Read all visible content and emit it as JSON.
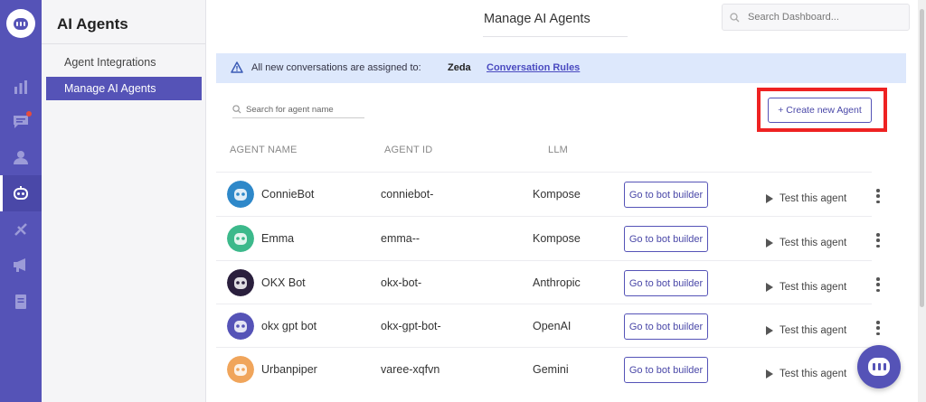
{
  "colors": {
    "brand": "#5553b7",
    "highlight": "#ee2222",
    "banner": "#dde8fc"
  },
  "rail": {
    "items": [
      {
        "icon": "reports-icon"
      },
      {
        "icon": "conversations-icon",
        "badge": true
      },
      {
        "icon": "contacts-icon"
      },
      {
        "icon": "ai-agents-icon",
        "active": true
      },
      {
        "icon": "integrations-icon"
      },
      {
        "icon": "campaigns-icon"
      },
      {
        "icon": "knowledge-base-icon"
      }
    ]
  },
  "sidebar": {
    "title": "AI Agents",
    "items": [
      {
        "label": "Agent Integrations"
      },
      {
        "label": "Manage AI Agents",
        "active": true
      }
    ]
  },
  "header": {
    "title": "Manage AI Agents",
    "search_placeholder": "Search Dashboard..."
  },
  "banner": {
    "text": "All new conversations are assigned to:",
    "assignee": "Zeda",
    "link": "Conversation Rules"
  },
  "agents_search_placeholder": "Search for agent name",
  "create_button": "+ Create new Agent",
  "table": {
    "columns": [
      "AGENT NAME",
      "AGENT ID",
      "LLM"
    ],
    "bot_builder_label": "Go to bot builder",
    "test_label": "Test this agent",
    "rows": [
      {
        "name": "ConnieBot",
        "id": "conniebot-",
        "llm": "Kompose",
        "avatar_color": "#2e88c9"
      },
      {
        "name": "Emma",
        "id": "emma--",
        "llm": "Kompose",
        "avatar_color": "#3cb98b"
      },
      {
        "name": "OKX Bot",
        "id": "okx-bot-",
        "llm": "Anthropic",
        "avatar_color": "#2a1f3d"
      },
      {
        "name": "okx gpt bot",
        "id": "okx-gpt-bot-",
        "llm": "OpenAI",
        "avatar_color": "#5553b7"
      },
      {
        "name": "Urbanpiper",
        "id": "varee-xqfvn",
        "llm": "Gemini",
        "avatar_color": "#f0a55b"
      }
    ]
  }
}
